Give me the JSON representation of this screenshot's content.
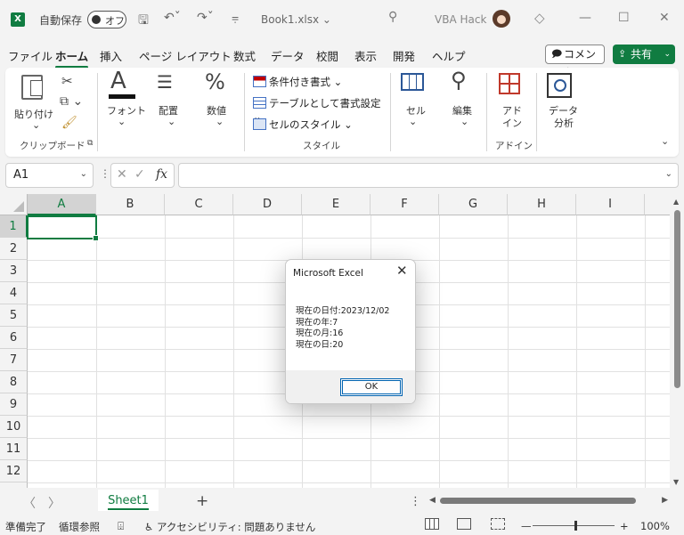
{
  "titlebar": {
    "logo": "X",
    "autosave_label": "自動保存",
    "autosave_state": "オフ",
    "filename": "Book1.xlsx",
    "user": "VBA Hack"
  },
  "tabs": [
    "ファイル",
    "ホーム",
    "挿入",
    "ページ レイアウト",
    "数式",
    "データ",
    "校閲",
    "表示",
    "開発",
    "ヘルプ"
  ],
  "active_tab": "ホーム",
  "comment_label": "コメント",
  "share_label": "共有",
  "ribbon": {
    "paste": "貼り付け",
    "clipboard": "クリップボード",
    "font": "フォント",
    "alignment": "配置",
    "number": "数値",
    "conditional": "条件付き書式",
    "table_format": "テーブルとして書式設定",
    "cell_style": "セルのスタイル",
    "styles": "スタイル",
    "cells": "セル",
    "editing": "編集",
    "addin_line1": "アド",
    "addin_line2": "イン",
    "addin_group": "アドイン",
    "data_line1": "データ",
    "data_line2": "分析"
  },
  "namebox": "A1",
  "fx": "fx",
  "columns": [
    "A",
    "B",
    "C",
    "D",
    "E",
    "F",
    "G",
    "H",
    "I"
  ],
  "rows": [
    "1",
    "2",
    "3",
    "4",
    "5",
    "6",
    "7",
    "8",
    "9",
    "10",
    "11",
    "12"
  ],
  "sheet_tab": "Sheet1",
  "status": {
    "ready": "準備完了",
    "circular": "循環参照",
    "accessibility": "アクセシビリティ: 問題ありません",
    "zoom": "100%"
  },
  "dialog": {
    "title": "Microsoft Excel",
    "lines": [
      "現在の日付:2023/12/02",
      "現在の年:7",
      "現在の月:16",
      "現在の日:20"
    ],
    "ok": "OK"
  },
  "colors": {
    "accent": "#107c41",
    "dialog_focus": "#0063b1"
  }
}
